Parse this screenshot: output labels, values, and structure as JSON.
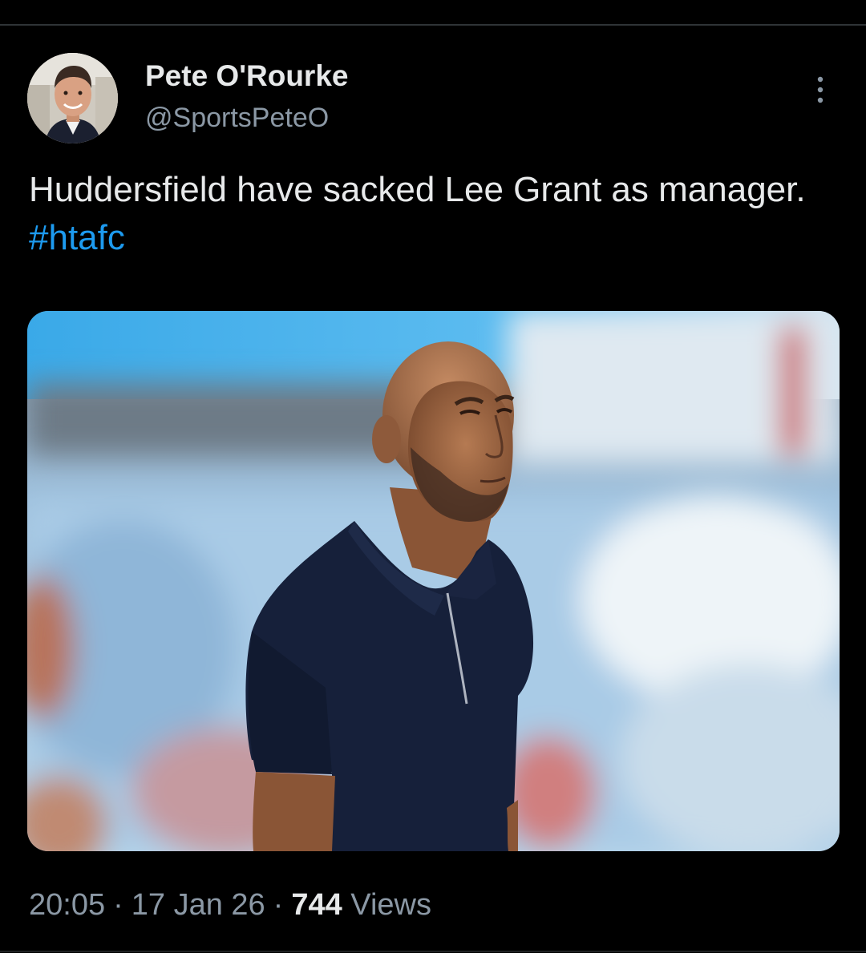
{
  "tweet": {
    "author": {
      "display_name": "Pete O'Rourke",
      "handle": "@SportsPeteO"
    },
    "text": "Huddersfield have sacked Lee Grant as manager.",
    "hashtag": "#htafc",
    "time": "20:05",
    "date": "17 Jan 26",
    "views_count": "744",
    "views_label": "Views",
    "separator": "·"
  },
  "icons": {
    "more": "more-vertical-icon"
  },
  "colors": {
    "background": "#000000",
    "text_primary": "#e7e9ea",
    "text_secondary": "#8b98a5",
    "link": "#1d9bf0"
  }
}
